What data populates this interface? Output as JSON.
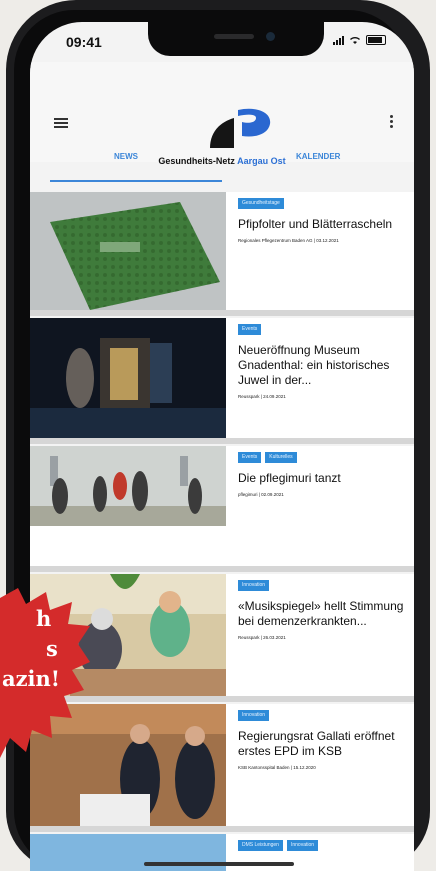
{
  "status": {
    "time": "09:41"
  },
  "header": {
    "brand_main": "Gesundheits-Netz",
    "brand_accent": "Aargau Ost",
    "menu_icon": "hamburger-menu-icon",
    "more_icon": "kebab-menu-icon"
  },
  "tabs": [
    {
      "label": "NEWS",
      "active": true
    },
    {
      "label": "KALENDER",
      "active": false
    }
  ],
  "articles": [
    {
      "tags": [
        "Gesundheitstage"
      ],
      "title": "Pfipfolter und Blätterrascheln",
      "meta": "Regionales Pflegezentrum Baden AG | 03.12.2021"
    },
    {
      "tags": [
        "Events"
      ],
      "title": "Neueröffnung Museum Gnadenthal: ein historisches Juwel in der...",
      "meta": "Reusspark | 24.09.2021"
    },
    {
      "tags": [
        "Events",
        "Kulturelles"
      ],
      "title": "Die pflegimuri tanzt",
      "meta": "pflegimuri | 02.09.2021"
    },
    {
      "tags": [
        "Innovation"
      ],
      "title": "«Musikspiegel» hellt Stimmung bei demenzerkrankten...",
      "meta": "Reusspark | 26.03.2021"
    },
    {
      "tags": [
        "Innovation"
      ],
      "title": "Regierungsrat Gallati eröffnet erstes EPD im KSB",
      "meta": "KSB Kantonsspital Baden | 15.12.2020"
    },
    {
      "tags": [
        "DMS Leistungen",
        "Innovation"
      ],
      "title": "",
      "meta": ""
    }
  ],
  "promo": {
    "lines": [
      "h",
      "s",
      "azin!"
    ]
  },
  "colors": {
    "accent": "#2e8bd8",
    "tab": "#3c86d8",
    "promo": "#d42b2b"
  }
}
